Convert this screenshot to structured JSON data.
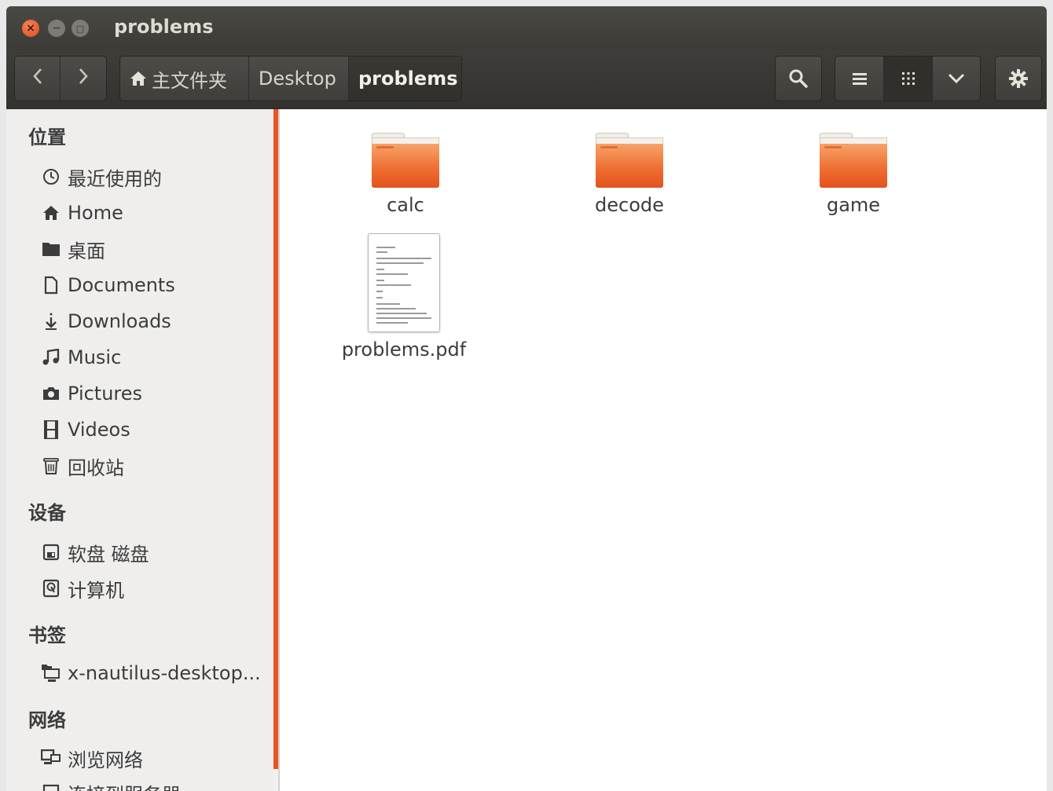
{
  "window": {
    "title": "problems",
    "controls": {
      "close": "×",
      "minimize": "−",
      "maximize": "□"
    }
  },
  "toolbar": {
    "back_icon": "chevron-left-icon",
    "forward_icon": "chevron-right-icon",
    "breadcrumbs": [
      {
        "label": "主文件夹",
        "icon": "home-icon"
      },
      {
        "label": "Desktop"
      },
      {
        "label": "problems",
        "active": true
      }
    ],
    "search_icon": "search-icon",
    "list_view_icon": "list-icon",
    "grid_view_icon": "grid-icon",
    "view_options_icon": "chevron-down-icon",
    "settings_icon": "gear-icon"
  },
  "sidebar": {
    "sections": [
      {
        "title": "位置"
      },
      {
        "title": "设备"
      },
      {
        "title": "书签"
      },
      {
        "title": "网络"
      }
    ],
    "places": [
      {
        "label": "最近使用的",
        "icon": "clock-icon"
      },
      {
        "label": "Home",
        "icon": "home-icon"
      },
      {
        "label": "桌面",
        "icon": "folder-icon"
      },
      {
        "label": "Documents",
        "icon": "document-icon"
      },
      {
        "label": "Downloads",
        "icon": "download-icon"
      },
      {
        "label": "Music",
        "icon": "music-icon"
      },
      {
        "label": "Pictures",
        "icon": "camera-icon"
      },
      {
        "label": "Videos",
        "icon": "film-icon"
      },
      {
        "label": "回收站",
        "icon": "trash-icon"
      }
    ],
    "devices": [
      {
        "label": "软盘 磁盘",
        "icon": "floppy-icon"
      },
      {
        "label": "计算机",
        "icon": "harddisk-icon"
      }
    ],
    "bookmarks": [
      {
        "label": "x-nautilus-desktop...",
        "icon": "desktop-icon"
      }
    ],
    "network": [
      {
        "label": "浏览网络",
        "icon": "network-icon"
      },
      {
        "label": "连接到服务器",
        "icon": "server-icon"
      }
    ]
  },
  "files": [
    {
      "name": "calc",
      "type": "folder"
    },
    {
      "name": "decode",
      "type": "folder"
    },
    {
      "name": "game",
      "type": "folder"
    },
    {
      "name": "problems.pdf",
      "type": "pdf"
    }
  ],
  "colors": {
    "accent": "#e95420",
    "titlebar": "#3c3b37",
    "sidebar_bg": "#efeeed"
  }
}
